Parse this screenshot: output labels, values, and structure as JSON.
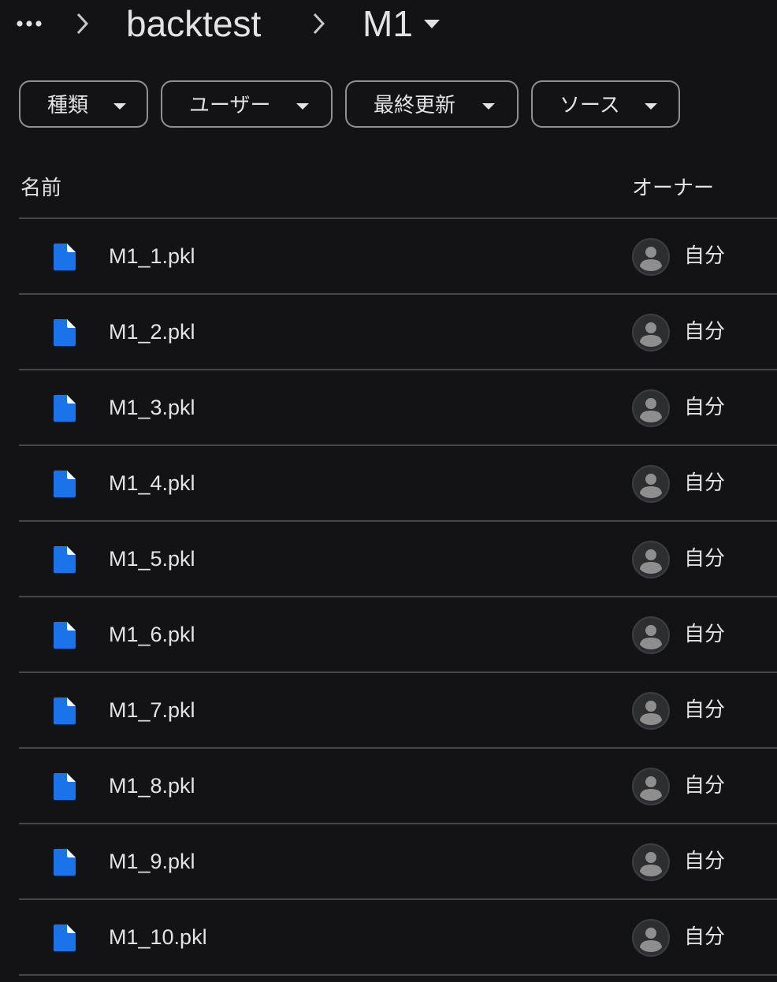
{
  "breadcrumb": {
    "more_icon": "more-horiz-icon",
    "separator_icon": "chevron-right-icon",
    "items": [
      {
        "label": "backtest"
      },
      {
        "label": "M1"
      }
    ],
    "current_dropdown_icon": "caret-down-icon"
  },
  "filters": [
    {
      "label": "種類"
    },
    {
      "label": "ユーザー"
    },
    {
      "label": "最終更新"
    },
    {
      "label": "ソース"
    }
  ],
  "columns": {
    "name": "名前",
    "owner": "オーナー"
  },
  "files": [
    {
      "name": "M1_1.pkl",
      "owner": "自分"
    },
    {
      "name": "M1_2.pkl",
      "owner": "自分"
    },
    {
      "name": "M1_3.pkl",
      "owner": "自分"
    },
    {
      "name": "M1_4.pkl",
      "owner": "自分"
    },
    {
      "name": "M1_5.pkl",
      "owner": "自分"
    },
    {
      "name": "M1_6.pkl",
      "owner": "自分"
    },
    {
      "name": "M1_7.pkl",
      "owner": "自分"
    },
    {
      "name": "M1_8.pkl",
      "owner": "自分"
    },
    {
      "name": "M1_9.pkl",
      "owner": "自分"
    },
    {
      "name": "M1_10.pkl",
      "owner": "自分"
    }
  ],
  "colors": {
    "background": "#131316",
    "text": "#e3e3e3",
    "file_icon": "#1a73e8",
    "divider": "#444746",
    "chip_border": "#8e918f",
    "avatar_bg": "#2d2e30",
    "avatar_fg": "#8e8e8e"
  }
}
